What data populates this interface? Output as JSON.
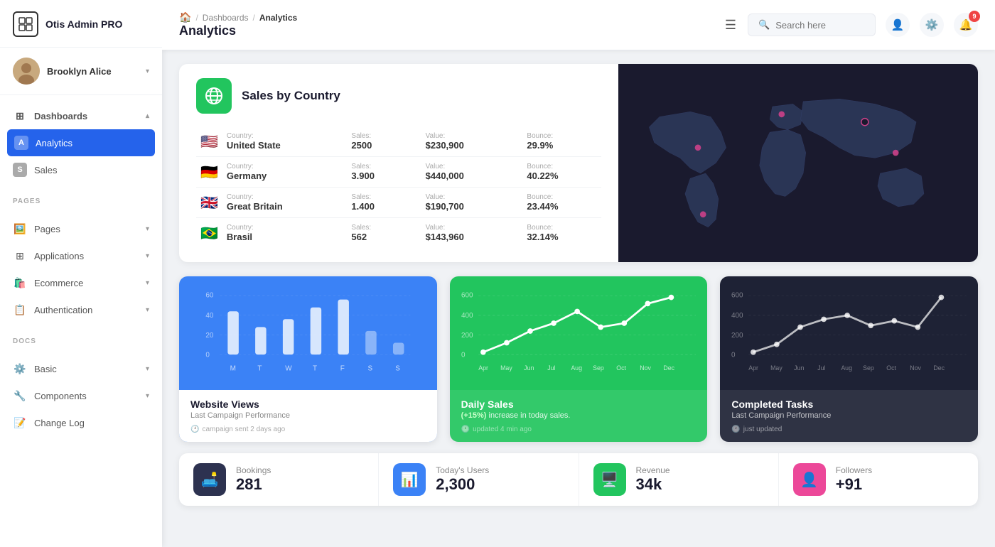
{
  "sidebar": {
    "logo": {
      "text": "Otis Admin PRO"
    },
    "user": {
      "name": "Brooklyn Alice"
    },
    "nav": {
      "dashboards_label": "Dashboards",
      "analytics_label": "Analytics",
      "sales_label": "Sales",
      "pages_section": "PAGES",
      "pages_label": "Pages",
      "applications_label": "Applications",
      "ecommerce_label": "Ecommerce",
      "authentication_label": "Authentication",
      "docs_section": "DOCS",
      "basic_label": "Basic",
      "components_label": "Components",
      "changelog_label": "Change Log"
    }
  },
  "topbar": {
    "breadcrumb_home": "🏠",
    "breadcrumb_dashboards": "Dashboards",
    "breadcrumb_analytics": "Analytics",
    "page_title": "Analytics",
    "search_placeholder": "Search here",
    "notif_count": "9"
  },
  "sales_country": {
    "title": "Sales by Country",
    "rows": [
      {
        "flag": "🇺🇸",
        "country_label": "Country:",
        "country": "United State",
        "sales_label": "Sales:",
        "sales": "2500",
        "value_label": "Value:",
        "value": "$230,900",
        "bounce_label": "Bounce:",
        "bounce": "29.9%"
      },
      {
        "flag": "🇩🇪",
        "country_label": "Country:",
        "country": "Germany",
        "sales_label": "Sales:",
        "sales": "3.900",
        "value_label": "Value:",
        "value": "$440,000",
        "bounce_label": "Bounce:",
        "bounce": "40.22%"
      },
      {
        "flag": "🇬🇧",
        "country_label": "Country:",
        "country": "Great Britain",
        "sales_label": "Sales:",
        "sales": "1.400",
        "value_label": "Value:",
        "value": "$190,700",
        "bounce_label": "Bounce:",
        "bounce": "23.44%"
      },
      {
        "flag": "🇧🇷",
        "country_label": "Country:",
        "country": "Brasil",
        "sales_label": "Sales:",
        "sales": "562",
        "value_label": "Value:",
        "value": "$143,960",
        "bounce_label": "Bounce:",
        "bounce": "32.14%"
      }
    ]
  },
  "website_views": {
    "title": "Website Views",
    "subtitle": "Last Campaign Performance",
    "time_text": "campaign sent 2 days ago",
    "y_labels": [
      "60",
      "40",
      "20",
      "0"
    ],
    "x_labels": [
      "M",
      "T",
      "W",
      "T",
      "F",
      "S",
      "S"
    ]
  },
  "daily_sales": {
    "title": "Daily Sales",
    "subtitle": "(+15%) increase in today sales.",
    "time_text": "updated 4 min ago",
    "y_labels": [
      "600",
      "400",
      "200",
      "0"
    ],
    "x_labels": [
      "Apr",
      "May",
      "Jun",
      "Jul",
      "Aug",
      "Sep",
      "Oct",
      "Nov",
      "Dec"
    ]
  },
  "completed_tasks": {
    "title": "Completed Tasks",
    "subtitle": "Last Campaign Performance",
    "time_text": "just updated",
    "y_labels": [
      "600",
      "400",
      "200",
      "0"
    ],
    "x_labels": [
      "Apr",
      "May",
      "Jun",
      "Jul",
      "Aug",
      "Sep",
      "Oct",
      "Nov",
      "Dec"
    ]
  },
  "stats": [
    {
      "icon": "🛋️",
      "icon_class": "dark",
      "label": "Bookings",
      "value": "281"
    },
    {
      "icon": "📊",
      "icon_class": "blue",
      "label": "Today's Users",
      "value": "2,300"
    },
    {
      "icon": "🖥️",
      "icon_class": "green",
      "label": "Revenue",
      "value": "34k"
    },
    {
      "icon": "👤",
      "icon_class": "pink",
      "label": "Followers",
      "value": "+91"
    }
  ]
}
